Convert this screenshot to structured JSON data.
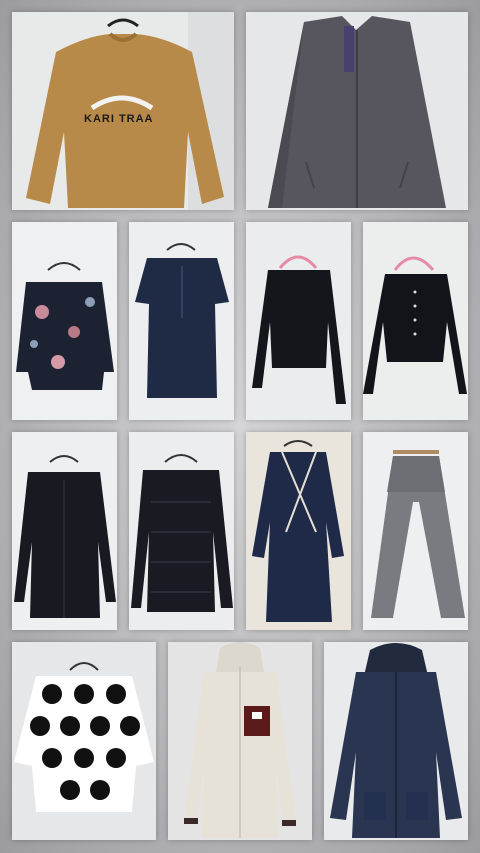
{
  "collage": {
    "background_color": "#b9b9bc",
    "photos": [
      {
        "id": "sweater-tan",
        "garment_color": "#b88a4a",
        "brand_print": "KARI TRAA"
      },
      {
        "id": "hoodie-grey",
        "garment_color": "#57565e"
      },
      {
        "id": "top-floral",
        "garment_color": "#1d2233"
      },
      {
        "id": "blouse-navy",
        "garment_color": "#1f2a44"
      },
      {
        "id": "top-black-long",
        "garment_color": "#15161c"
      },
      {
        "id": "cardigan-black",
        "garment_color": "#13141a"
      },
      {
        "id": "shirt-black",
        "garment_color": "#181a22"
      },
      {
        "id": "lace-top-black",
        "garment_color": "#191a22"
      },
      {
        "id": "wrap-dress-navy",
        "garment_color": "#1e2a48"
      },
      {
        "id": "trousers-checked",
        "garment_color": "#7a7b80"
      },
      {
        "id": "top-polka-dot",
        "garment_color": "#ffffff"
      },
      {
        "id": "fleece-cream",
        "garment_color": "#e7e2d8"
      },
      {
        "id": "parka-navy",
        "garment_color": "#2a3552"
      }
    ]
  }
}
